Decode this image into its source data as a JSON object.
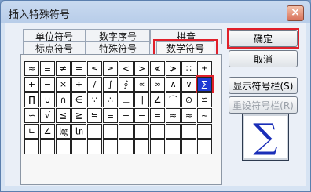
{
  "window": {
    "title": "插入特殊符号",
    "close_label": "×"
  },
  "tabs": {
    "row1": [
      "单位符号",
      "数字序号",
      "拼音"
    ],
    "row2": [
      "标点符号",
      "特殊符号",
      "数学符号"
    ],
    "active": "数学符号"
  },
  "symbols": [
    "≈",
    "≡",
    "≠",
    "=",
    "≤",
    "≥",
    "<",
    ">",
    "≮",
    "≯",
    "∷",
    "±",
    "+",
    "−",
    "×",
    "÷",
    "/",
    "∫",
    "∮",
    "∝",
    "∞",
    "∧",
    "∨",
    "∑",
    "∏",
    "∪",
    "∩",
    "∈",
    "∵",
    "∴",
    "⊥",
    "∥",
    "∠",
    "⌒",
    "⊙",
    "≌",
    "∽",
    "√",
    "≦",
    "≧",
    "≒",
    "≡",
    "+",
    "−",
    "=",
    "≈",
    "≈",
    "~",
    "∟",
    "∠",
    "㏒",
    "㏑",
    "",
    "",
    "",
    "",
    "",
    "",
    "",
    "",
    "",
    "",
    "",
    "",
    "",
    "",
    "",
    "",
    "",
    "",
    "",
    ""
  ],
  "selected_symbol_index": 23,
  "buttons": {
    "ok": "确定",
    "cancel": "取消",
    "show_bar": "显示符号栏(S)",
    "reset_bar": "重设符号栏(R)"
  },
  "preview": {
    "symbol": "∑"
  },
  "colors": {
    "highlight": "#e0202a",
    "selected_bg": "#1f3ad3"
  }
}
